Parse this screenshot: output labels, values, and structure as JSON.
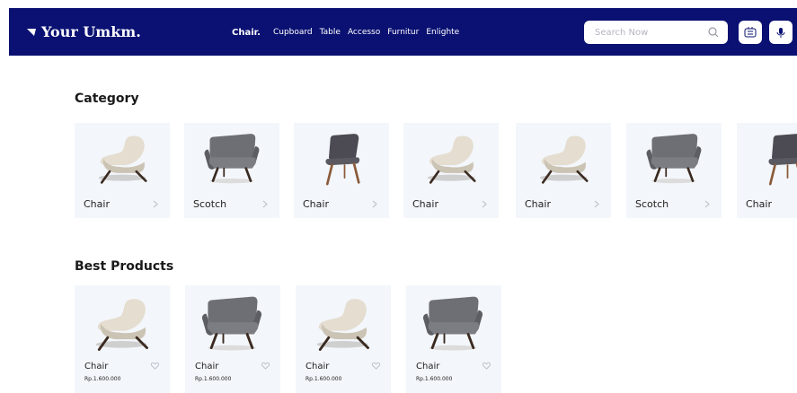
{
  "header": {
    "logo": "Your Umkm.",
    "nav": [
      "Chair.",
      "Cupboard",
      "Table",
      "Accesso",
      "Furnitur",
      "Enlighte"
    ],
    "search_placeholder": "Search Now",
    "icons": [
      "search-icon",
      "grid-icon",
      "microphone-icon"
    ]
  },
  "colors": {
    "navbar": "#0a1172",
    "card": "#f3f6fa"
  },
  "category": {
    "title": "Category",
    "items": [
      {
        "label": "Chair",
        "style": "beige"
      },
      {
        "label": "Scotch",
        "style": "grey"
      },
      {
        "label": "Chair",
        "style": "dark"
      },
      {
        "label": "Chair",
        "style": "beige"
      },
      {
        "label": "Chair",
        "style": "beige"
      },
      {
        "label": "Scotch",
        "style": "grey"
      },
      {
        "label": "Chair",
        "style": "dark"
      }
    ]
  },
  "best_products": {
    "title": "Best Products",
    "items": [
      {
        "name": "Chair",
        "price": "Rp.1.600.000",
        "style": "beige"
      },
      {
        "name": "Chair",
        "price": "Rp.1.600.000",
        "style": "grey"
      },
      {
        "name": "Chair",
        "price": "Rp.1.600.000",
        "style": "beige"
      },
      {
        "name": "Chair",
        "price": "Rp.1.600.000",
        "style": "grey"
      }
    ]
  }
}
